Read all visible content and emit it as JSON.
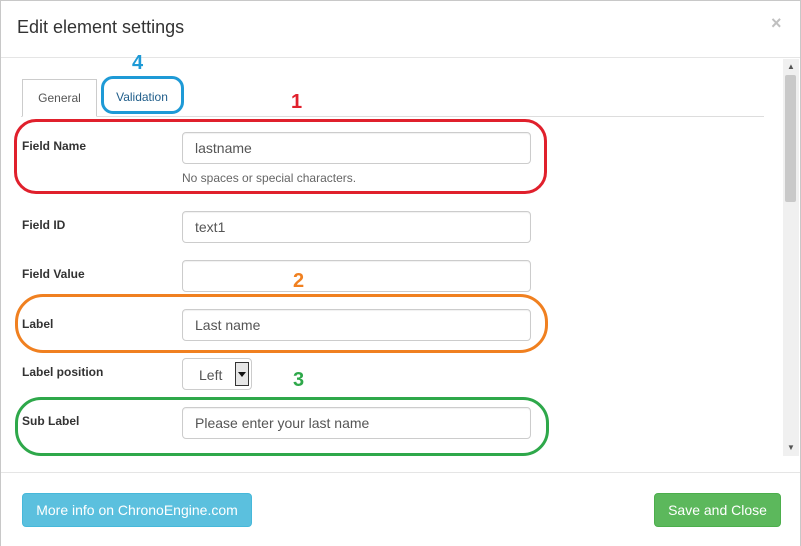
{
  "modal": {
    "title": "Edit element settings",
    "close_symbol": "×"
  },
  "tabs": [
    {
      "label": "General",
      "active": true
    },
    {
      "label": "Validation",
      "active": false
    }
  ],
  "fields": {
    "field_name": {
      "label": "Field Name",
      "value": "lastname",
      "help": "No spaces or special characters."
    },
    "field_id": {
      "label": "Field ID",
      "value": "text1"
    },
    "field_value": {
      "label": "Field Value",
      "value": ""
    },
    "label": {
      "label": "Label",
      "value": "Last name"
    },
    "label_position": {
      "label": "Label position",
      "selected": "Left"
    },
    "sub_label": {
      "label": "Sub Label",
      "value": "Please enter your last name"
    }
  },
  "annotations": [
    {
      "number": "1",
      "color": "#e0202c"
    },
    {
      "number": "2",
      "color": "#f08020"
    },
    {
      "number": "3",
      "color": "#2ea84a"
    },
    {
      "number": "4",
      "color": "#1e9ad6"
    }
  ],
  "footer": {
    "info_button": "More info on ChronoEngine.com",
    "save_button": "Save and Close"
  },
  "icons": {
    "close": "close-icon",
    "scroll_up": "arrow-up-icon",
    "scroll_down": "arrow-down-icon",
    "dropdown": "caret-down-icon"
  }
}
